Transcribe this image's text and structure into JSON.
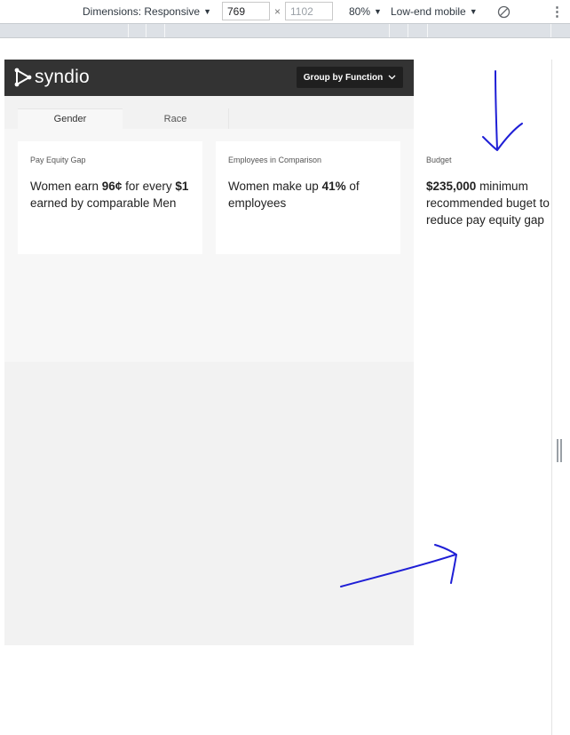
{
  "devtools": {
    "dimensions_label": "Dimensions: Responsive",
    "width_value": "769",
    "height_value": "1102",
    "times_symbol": "×",
    "zoom": "80%",
    "throttle": "Low-end mobile",
    "caret": "▼",
    "more_icon": "⋮"
  },
  "app": {
    "logo_text": "syndio",
    "group_button_label": "Group by Function",
    "tabs": [
      {
        "label": "Gender",
        "active": true
      },
      {
        "label": "Race",
        "active": false
      }
    ],
    "cards": [
      {
        "label": "Pay Equity Gap",
        "t1": "Women earn ",
        "b1": "96¢",
        "t2": " for every ",
        "b2": "$1",
        "t3": " earned by comparable Men"
      },
      {
        "label": "Employees in Comparison",
        "t1": "Women make up ",
        "b1": "41%",
        "t2": " of employees"
      },
      {
        "label": "Budget",
        "b1": "$235,000",
        "t1": " minimum",
        "line2": "recommended buget to",
        "line3": "reduce pay equity gap"
      }
    ]
  },
  "colors": {
    "header_bg": "#333333",
    "annotation_ink": "#1f1fd6"
  }
}
